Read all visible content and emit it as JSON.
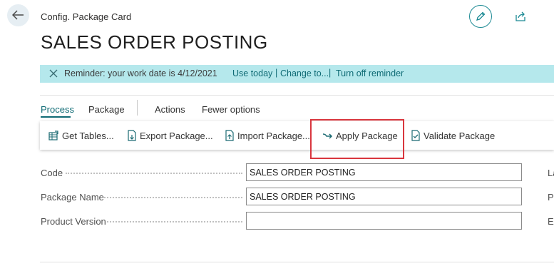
{
  "header": {
    "breadcrumb": "Config. Package Card",
    "title": "SALES ORDER POSTING"
  },
  "reminder": {
    "text": "Reminder: your work date is 4/12/2021",
    "use_today": "Use today",
    "change_to": "Change to...",
    "turn_off": "Turn off reminder",
    "separator": "|",
    "background": "#b5e8ec"
  },
  "tabs": [
    "Process",
    "Package",
    "Actions",
    "Fewer options"
  ],
  "toolbar": {
    "get_tables": "Get Tables...",
    "export_package": "Export Package...",
    "import_package": "Import Package...",
    "apply_package": "Apply Package",
    "validate_package": "Validate Package"
  },
  "fields": {
    "code": {
      "label": "Code",
      "value": "SALES ORDER POSTING"
    },
    "package_name": {
      "label": "Package Name",
      "value": "SALES ORDER POSTING"
    },
    "product_version": {
      "label": "Product Version",
      "value": ""
    }
  },
  "right_labels": [
    "La",
    "P",
    "Ex"
  ],
  "colors": {
    "accent": "#0f6b75",
    "highlight": "#d9363e"
  },
  "icons": [
    "back-arrow-icon",
    "edit-pencil-icon",
    "share-icon",
    "close-icon",
    "get-tables-icon",
    "export-icon",
    "import-icon",
    "apply-arrow-icon",
    "validate-icon"
  ]
}
